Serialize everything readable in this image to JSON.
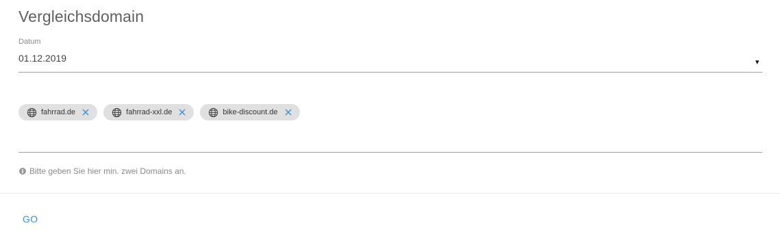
{
  "title": "Vergleichsdomain",
  "date": {
    "label": "Datum",
    "value": "01.12.2019",
    "arrow": "▾"
  },
  "domains": [
    {
      "label": "fahrrad.de",
      "icon": "globe-icon",
      "remove_icon": "close-icon"
    },
    {
      "label": "fahrrad-xxl.de",
      "icon": "globe-icon",
      "remove_icon": "close-icon"
    },
    {
      "label": "bike-discount.de",
      "icon": "globe-icon",
      "remove_icon": "close-icon"
    }
  ],
  "hint": {
    "icon": "info-icon",
    "icon_glyph": "i",
    "text": "Bitte geben Sie hier min. zwei Domains an."
  },
  "actions": {
    "go_label": "GO"
  },
  "colors": {
    "accent": "#3b8fd6",
    "chip_bg": "#e0e0e0",
    "remove_icon": "#3b8fd6"
  }
}
